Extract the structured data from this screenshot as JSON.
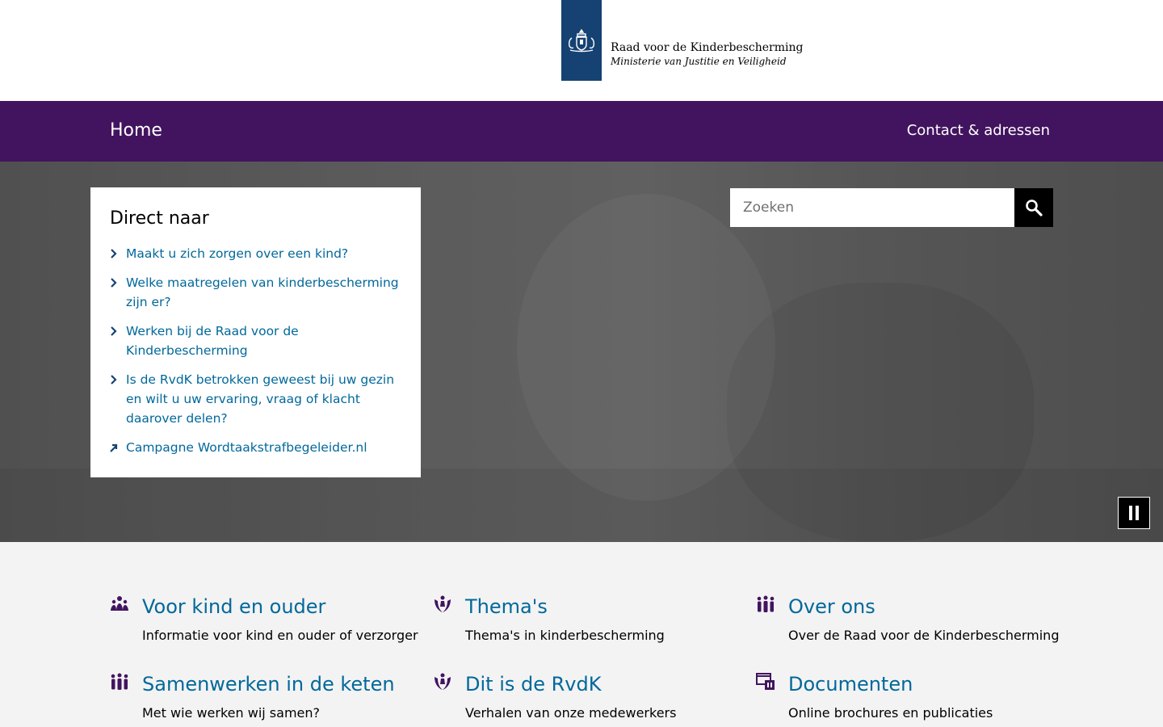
{
  "header": {
    "org_name": "Raad voor de Kinderbescherming",
    "ministry": "Ministerie van Justitie en Veiligheid",
    "logo_icon": "coat-of-arms-icon",
    "brand_color": "#154273"
  },
  "nav": {
    "home_label": "Home",
    "contact_label": "Contact & adressen",
    "color": "#42145f"
  },
  "direct": {
    "title": "Direct naar",
    "items": [
      {
        "label": "Maakt u zich zorgen over een kind?",
        "icon": "chevron-right-icon"
      },
      {
        "label": "Welke maatregelen van kinderbescherming zijn er?",
        "icon": "chevron-right-icon"
      },
      {
        "label": "Werken bij de Raad voor de Kinderbescherming",
        "icon": "chevron-right-icon"
      },
      {
        "label": "Is de RvdK betrokken geweest bij uw gezin en wilt u uw ervaring, vraag of klacht daarover delen?",
        "icon": "chevron-right-icon"
      },
      {
        "label": "Campagne Wordtaakstrafbegeleider.nl",
        "icon": "external-link-icon"
      }
    ]
  },
  "search": {
    "placeholder": "Zoeken",
    "icon": "search-icon"
  },
  "carousel": {
    "pause_icon": "pause-icon"
  },
  "tiles": [
    {
      "title": "Voor kind en ouder",
      "description": "Informatie voor kind en ouder of verzorger",
      "icon": "family-icon"
    },
    {
      "title": "Thema's",
      "description": "Thema's in kinderbescherming",
      "icon": "protecting-hands-icon"
    },
    {
      "title": "Over ons",
      "description": "Over de Raad voor de Kinderbescherming",
      "icon": "group-icon"
    },
    {
      "title": "Samenwerken in de keten",
      "description": "Met wie werken wij samen?",
      "icon": "group-icon"
    },
    {
      "title": "Dit is de RvdK",
      "description": "Verhalen van onze medewerkers",
      "icon": "protecting-hands-icon"
    },
    {
      "title": "Documenten",
      "description": "Online brochures en publicaties",
      "icon": "documents-icon"
    }
  ],
  "colors": {
    "link": "#01689b",
    "icon": "#42145f"
  }
}
